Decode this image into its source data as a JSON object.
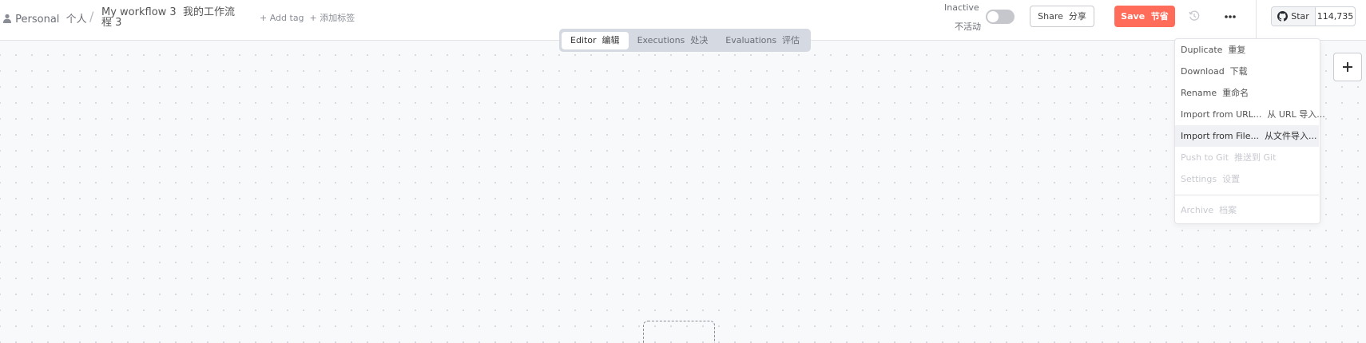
{
  "breadcrumb": {
    "project_label": "Personal  个人",
    "separator": "/",
    "workflow_name": "My workflow 3  我的工作流程 3",
    "add_tag_label": "+ Add tag  + 添加标签"
  },
  "status": {
    "inactive_label": "Inactive",
    "inactive_label_zh": "不活动",
    "active": false
  },
  "actions": {
    "share_label": "Share  分享",
    "save_label": "Save  节省",
    "history_icon": "history-icon",
    "more_icon": "more-horizontal-icon"
  },
  "github": {
    "star_label": "Star",
    "star_count": "114,735"
  },
  "tabs": [
    {
      "label": "Editor  编辑",
      "active": true
    },
    {
      "label": "Executions  处决",
      "active": false
    },
    {
      "label": "Evaluations  评估",
      "active": false
    }
  ],
  "menu": {
    "items": [
      {
        "label": "Duplicate  重复",
        "state": "normal"
      },
      {
        "label": "Download  下载",
        "state": "normal"
      },
      {
        "label": "Rename  重命名",
        "state": "normal"
      },
      {
        "label": "Import from URL...  从 URL 导入...",
        "state": "normal"
      },
      {
        "label": "Import from File...  从文件导入...",
        "state": "hover"
      },
      {
        "label": "Push to Git  推送到 Git",
        "state": "disabled"
      },
      {
        "label": "Settings  设置",
        "state": "disabled"
      },
      {
        "label": "Archive  档案",
        "state": "disabled"
      }
    ]
  },
  "canvas": {
    "add_node_icon": "plus-icon"
  },
  "colors": {
    "accent": "#ff6d5a",
    "header_bg": "#ffffff",
    "canvas_bg": "#f8f9fb",
    "tabs_bg": "#d5d9e2"
  }
}
